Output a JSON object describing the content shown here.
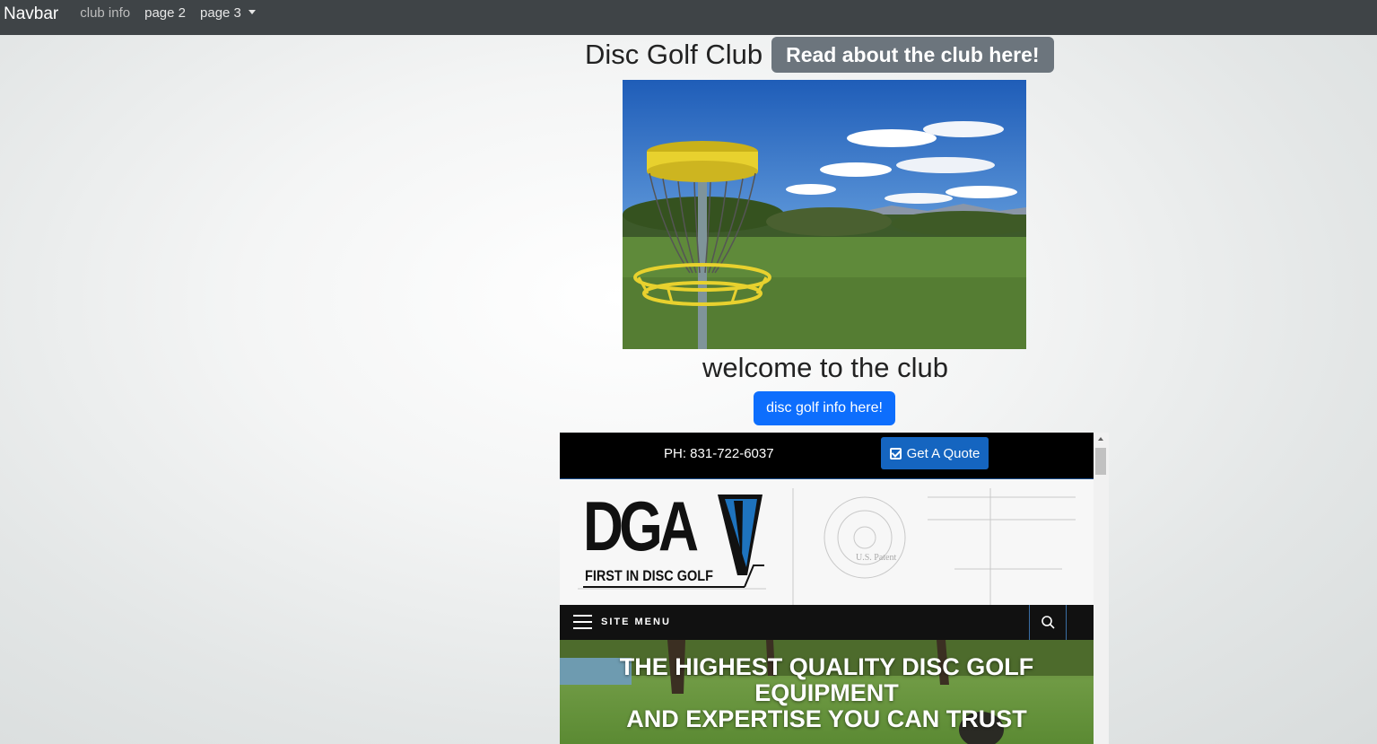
{
  "navbar": {
    "brand": "Navbar",
    "links": [
      "club info",
      "page 2",
      "page 3"
    ]
  },
  "header": {
    "title": "Disc Golf Club",
    "read_button": "Read about the club here!"
  },
  "main": {
    "welcome": "welcome to the club",
    "info_button": "disc golf info here!"
  },
  "embed": {
    "phone": "PH: 831-722-6037",
    "quote_button": "Get A Quote",
    "logo_text": "DGA",
    "logo_tagline": "FIRST IN DISC GOLF",
    "blueprint_text": "U.S. Patent",
    "site_menu": "SITE MENU",
    "hero_line1": "THE HIGHEST QUALITY DISC GOLF",
    "hero_line2": "EQUIPMENT",
    "hero_line3": "AND EXPERTISE YOU CAN TRUST"
  },
  "colors": {
    "navbar_bg": "#3f4447",
    "read_button_bg": "#6c757d",
    "info_button_bg": "#0d6efd",
    "quote_button_bg": "#1565c0",
    "logo_accent": "#1e73be"
  }
}
